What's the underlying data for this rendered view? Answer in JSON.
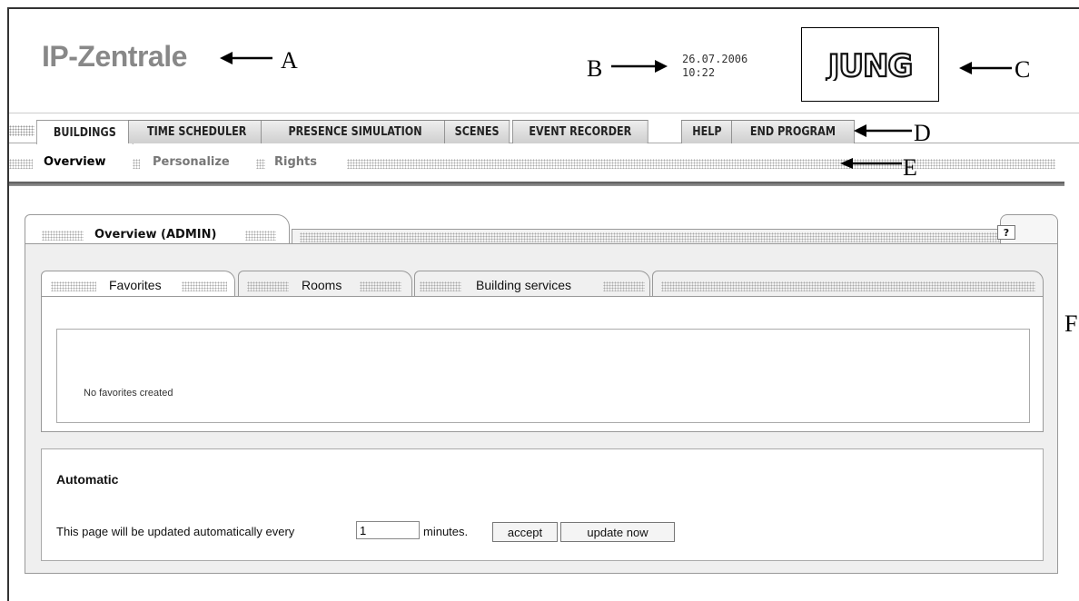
{
  "header": {
    "app_title": "IP-Zentrale",
    "date": "26.07.2006",
    "time": "10:22",
    "logo_text": "JUNG"
  },
  "annotations": {
    "a": "A",
    "b": "B",
    "c": "C",
    "d": "D",
    "e": "E",
    "f": "F"
  },
  "main_menu": {
    "tabs": [
      "BUILDINGS",
      "TIME SCHEDULER",
      "PRESENCE SIMULATION",
      "SCENES",
      "EVENT RECORDER"
    ],
    "right_tabs": [
      "HELP",
      "END PROGRAM"
    ],
    "active": "BUILDINGS"
  },
  "sub_menu": {
    "items": [
      "Overview",
      "Personalize",
      "Rights"
    ],
    "active": "Overview"
  },
  "panel": {
    "title": "Overview  (ADMIN)",
    "help_label": "?",
    "inner_tabs": [
      "Favorites",
      "Rooms",
      "Building services"
    ],
    "active_inner_tab": "Favorites",
    "empty_message": "No favorites created"
  },
  "automatic": {
    "title": "Automatic",
    "text_before": "This page will be updated automatically every",
    "minutes_value": "1",
    "text_after": "minutes.",
    "accept_label": "accept",
    "update_label": "update now"
  },
  "icons": [
    "arrow-left-icon",
    "arrow-right-icon",
    "grip-dots-icon",
    "jung-logo"
  ]
}
